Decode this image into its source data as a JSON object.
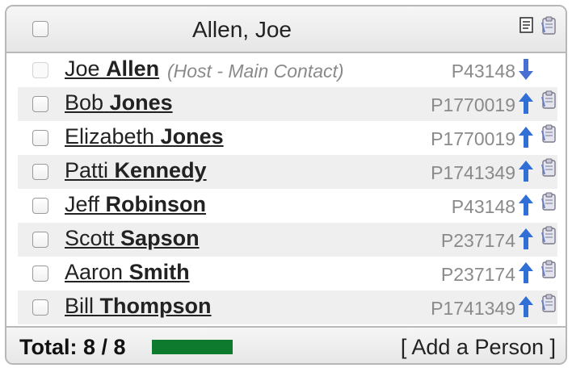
{
  "header": {
    "title": "Allen, Joe",
    "icons": [
      "document-icon",
      "clipboard-icon"
    ]
  },
  "people": [
    {
      "first": "Joe",
      "last": "Allen",
      "note": "(Host - Main Contact)",
      "pid": "P43148",
      "arrow": "down"
    },
    {
      "first": "Bob",
      "last": "Jones",
      "note": "",
      "pid": "P1770019",
      "arrow": "up"
    },
    {
      "first": "Elizabeth",
      "last": "Jones",
      "note": "",
      "pid": "P1770019",
      "arrow": "up"
    },
    {
      "first": "Patti",
      "last": "Kennedy",
      "note": "",
      "pid": "P1741349",
      "arrow": "up"
    },
    {
      "first": "Jeff",
      "last": "Robinson",
      "note": "",
      "pid": "P43148",
      "arrow": "up"
    },
    {
      "first": "Scott",
      "last": "Sapson",
      "note": "",
      "pid": "P237174",
      "arrow": "up"
    },
    {
      "first": "Aaron",
      "last": "Smith",
      "note": "",
      "pid": "P237174",
      "arrow": "up"
    },
    {
      "first": "Bill",
      "last": "Thompson",
      "note": "",
      "pid": "P1741349",
      "arrow": "up"
    }
  ],
  "footer": {
    "total_label": "Total: 8 / 8",
    "progress_fraction": 1.0,
    "progress_color": "#0e7a2e",
    "add_person_label": "[ Add a Person ]"
  },
  "colors": {
    "arrow_up": "#2f6fd6",
    "arrow_down": "#4a6fd4"
  }
}
